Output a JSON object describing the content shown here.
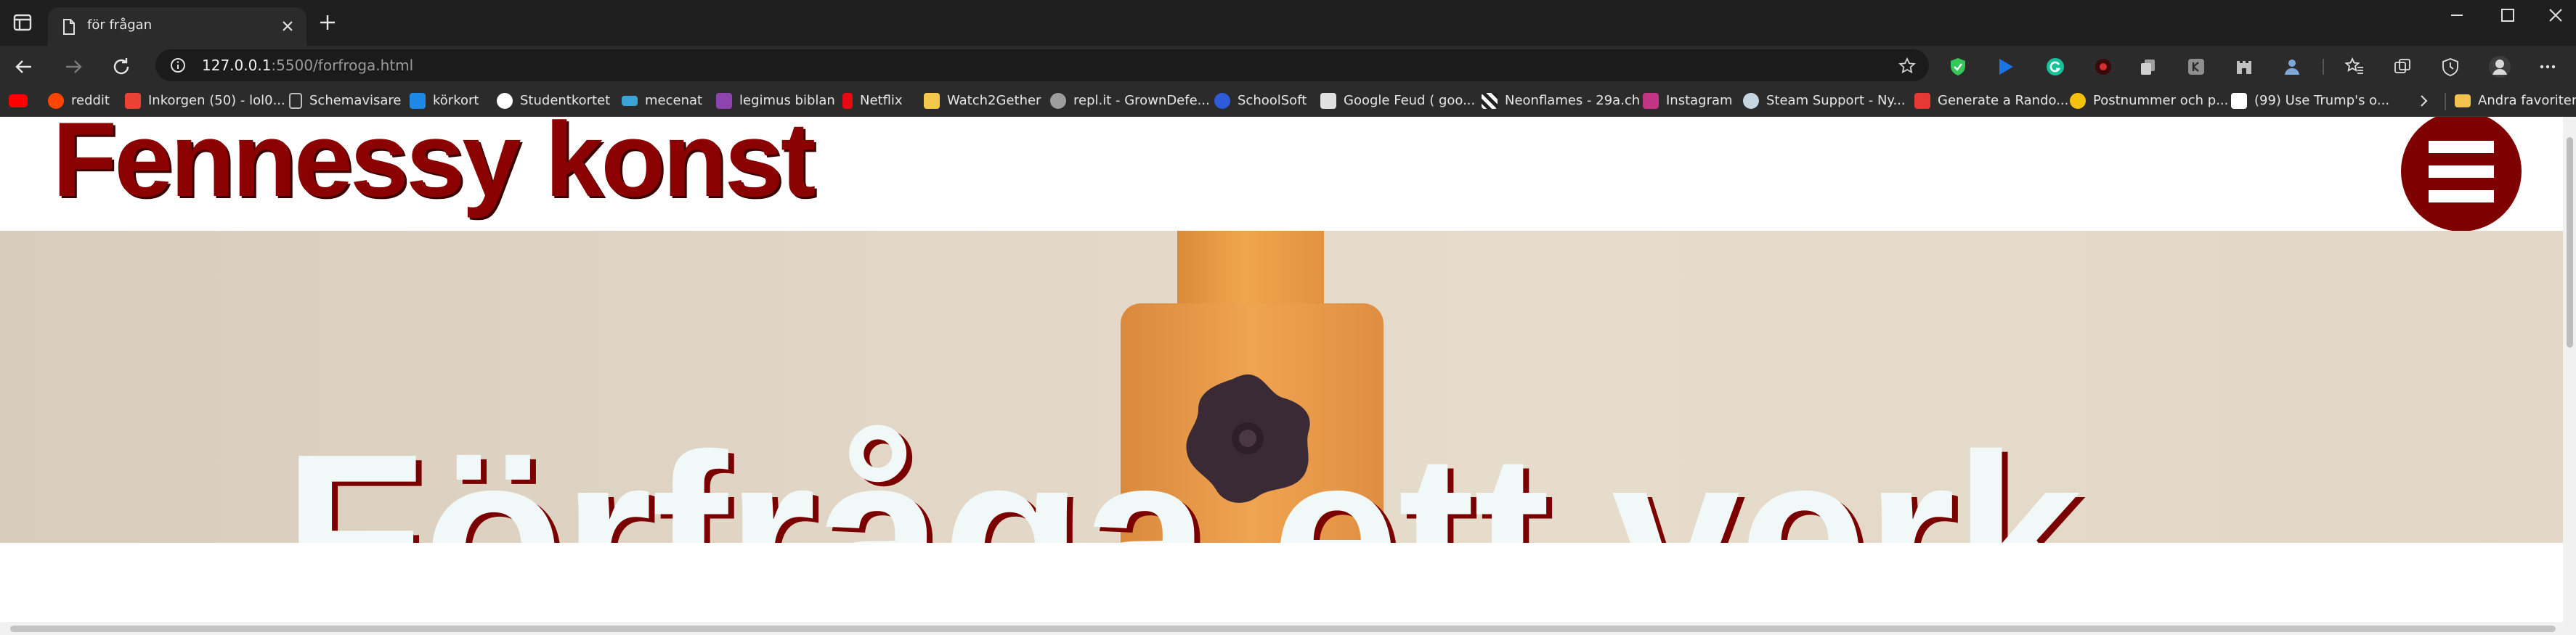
{
  "browser": {
    "tab": {
      "title": "för frågan"
    },
    "address_bar": {
      "url_host": "127.0.0.1",
      "url_rest": ":5500/forfroga.html"
    },
    "bookmarks": [
      {
        "label": "reddit",
        "icon": "reddit-icon",
        "color": "#ff4500"
      },
      {
        "label": "Inkorgen (50) - lol0...",
        "icon": "gmail-icon",
        "color": "#ea4335"
      },
      {
        "label": "Schemavisare",
        "icon": "document-icon",
        "color": "#bdbdbd"
      },
      {
        "label": "körkort",
        "icon": "korkort-icon",
        "color": "#1e88e5"
      },
      {
        "label": "Studentkortet",
        "icon": "studentkortet-icon",
        "color": "#ffffff"
      },
      {
        "label": "mecenat",
        "icon": "mecenat-icon",
        "color": "#3ba3d6"
      },
      {
        "label": "legimus biblan",
        "icon": "legimus-icon",
        "color": "#8e44ad"
      },
      {
        "label": "Netflix",
        "icon": "netflix-icon",
        "color": "#e50914"
      },
      {
        "label": "Watch2Gether",
        "icon": "watch2gether-icon",
        "color": "#f2c94c"
      },
      {
        "label": "repl.it - GrownDefe...",
        "icon": "replit-icon",
        "color": "#9e9e9e"
      },
      {
        "label": "SchoolSoft",
        "icon": "schoolsoft-icon",
        "color": "#2e5bd8"
      },
      {
        "label": "Google Feud ( goo...",
        "icon": "google-feud-icon",
        "color": "#e0e0e0"
      },
      {
        "label": "Neonflames - 29a.ch",
        "icon": "neonflames-icon",
        "color": "#ffffff"
      },
      {
        "label": "Instagram",
        "icon": "instagram-icon",
        "color": "#c13584"
      },
      {
        "label": "Steam Support - Ny...",
        "icon": "steam-icon",
        "color": "#c7d5e0"
      },
      {
        "label": "Generate a Rando...",
        "icon": "generator-icon",
        "color": "#e53935"
      },
      {
        "label": "Postnummer och p...",
        "icon": "postnummer-icon",
        "color": "#f4c20d"
      },
      {
        "label": "(99) Use Trump's o...",
        "icon": "youtube-icon",
        "color": "#ffffff"
      }
    ],
    "other_favorites": "Andra favoriter"
  },
  "page": {
    "logo_text": "Fennessy konst",
    "hero_title": "Förfråga ett verk"
  },
  "colors": {
    "brand": "#8b0000",
    "menu_button": "#7f0000",
    "chrome_dark": "#1f1f1f",
    "chrome_toolbar": "#2b2b2b"
  }
}
